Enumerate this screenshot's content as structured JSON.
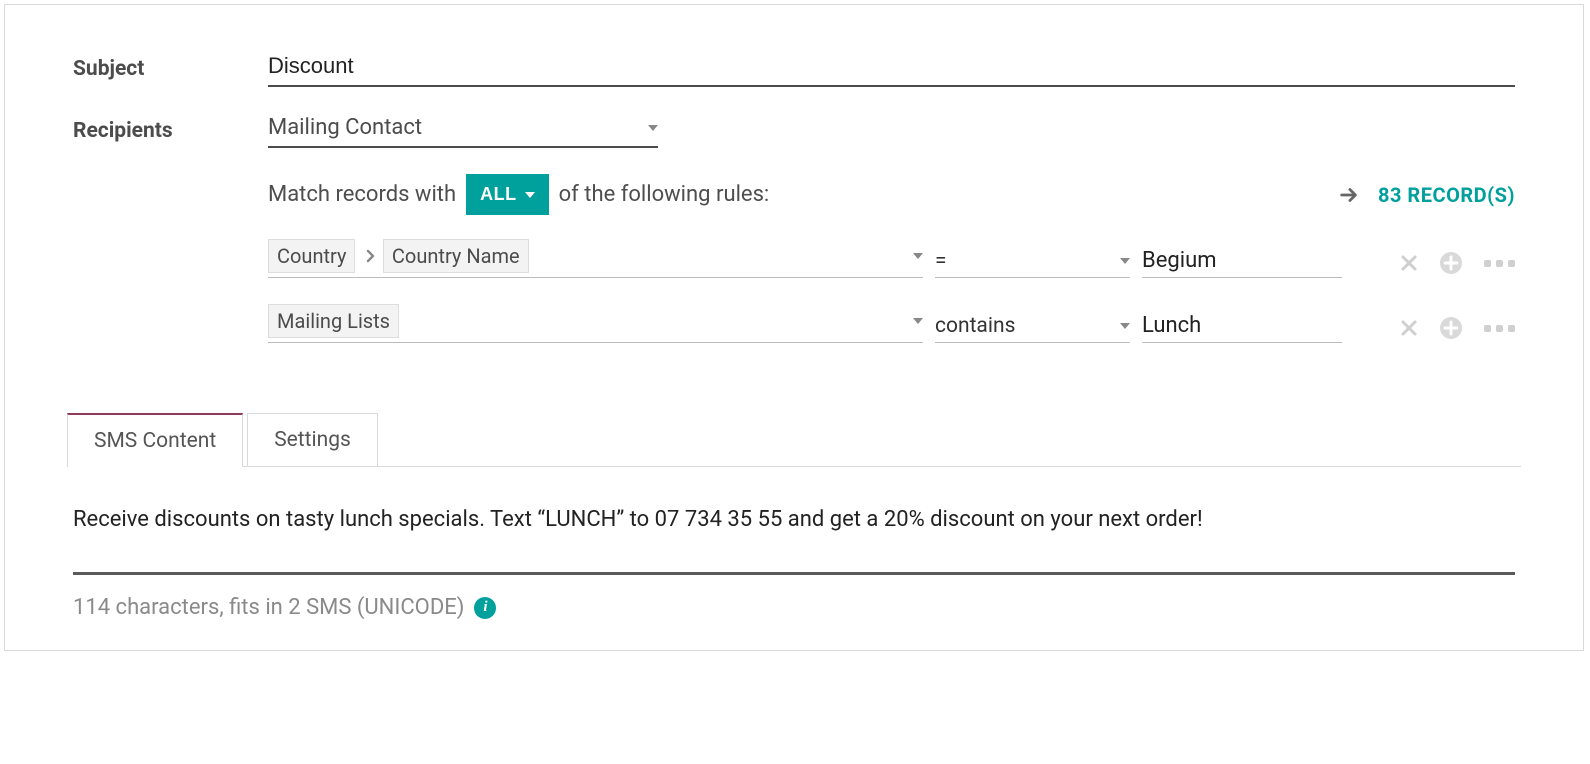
{
  "labels": {
    "subject": "Subject",
    "recipients": "Recipients"
  },
  "subject": "Discount",
  "recipient_model": "Mailing Contact",
  "match": {
    "prefix": "Match records with",
    "mode": "ALL",
    "suffix": "of the following rules:",
    "record_count_label": "83 RECORD(S)"
  },
  "rules": [
    {
      "chain": [
        "Country",
        "Country Name"
      ],
      "operator": "=",
      "value": "Begium"
    },
    {
      "chain": [
        "Mailing Lists"
      ],
      "operator": "contains",
      "value": "Lunch"
    }
  ],
  "tabs": [
    {
      "label": "SMS Content",
      "active": true
    },
    {
      "label": "Settings",
      "active": false
    }
  ],
  "sms_body": "Receive discounts on tasty lunch specials. Text “LUNCH” to 07 734 35 55 and get a 20% discount on your next order!",
  "char_info": "114 characters, fits in 2 SMS (UNICODE)"
}
